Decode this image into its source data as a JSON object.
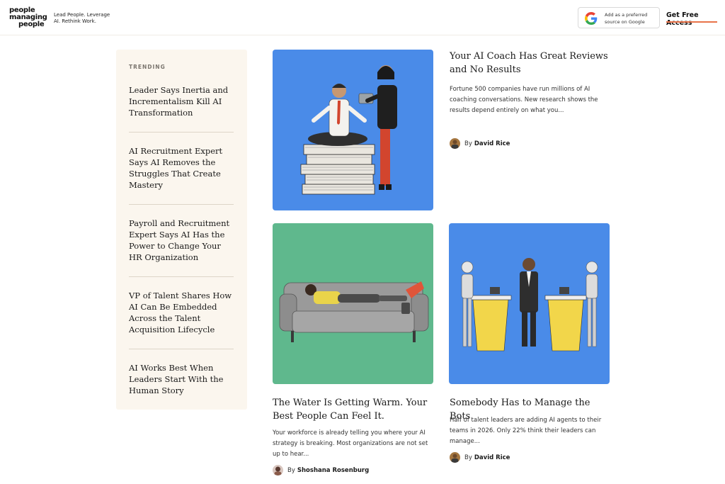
{
  "header": {
    "logo_lines": [
      "people",
      "managing",
      "people"
    ],
    "tagline": "Lead People. Leverage AI. Rethink Work.",
    "google_badge": "Add as a preferred source on Google",
    "cta_label": "Get Free Access",
    "accent_color": "#e8734a"
  },
  "trending": {
    "label": "TRENDING",
    "items": [
      "Leader Says Inertia and Incrementalism Kill AI Transformation",
      "AI Recruitment Expert Says AI Removes the Struggles That Create Mastery",
      "Payroll and Recruitment Expert Says AI Has the Power to Change Your HR Organization",
      "VP of Talent Shares How AI Can Be Embedded Across the Talent Acquisition Lifecycle",
      "AI Works Best When Leaders Start With the Human Story"
    ]
  },
  "articles": [
    {
      "title": "Your AI Coach Has Great Reviews and No Results",
      "excerpt": "Fortune 500 companies have run millions of AI coaching conversations. New research shows the results depend entirely on what you...",
      "by": "By",
      "author": "David Rice",
      "image_bg": "#4a8be8",
      "image_icon": "coach-illustration-icon"
    },
    {
      "title": "The Water Is Getting Warm. Your Best People Can Feel It.",
      "excerpt": "Your workforce is already telling you where your AI strategy is breaking. Most organizations are not set up to hear...",
      "by": "By",
      "author": "Shoshana Rosenburg",
      "image_bg": "#5fb88d",
      "image_icon": "sofa-illustration-icon"
    },
    {
      "title": "Somebody Has to Manage the Bots",
      "excerpt": "Half of talent leaders are adding AI agents to their teams in 2026. Only 22% think their leaders can manage...",
      "by": "By",
      "author": "David Rice",
      "image_bg": "#4a8be8",
      "image_icon": "robots-illustration-icon"
    }
  ]
}
